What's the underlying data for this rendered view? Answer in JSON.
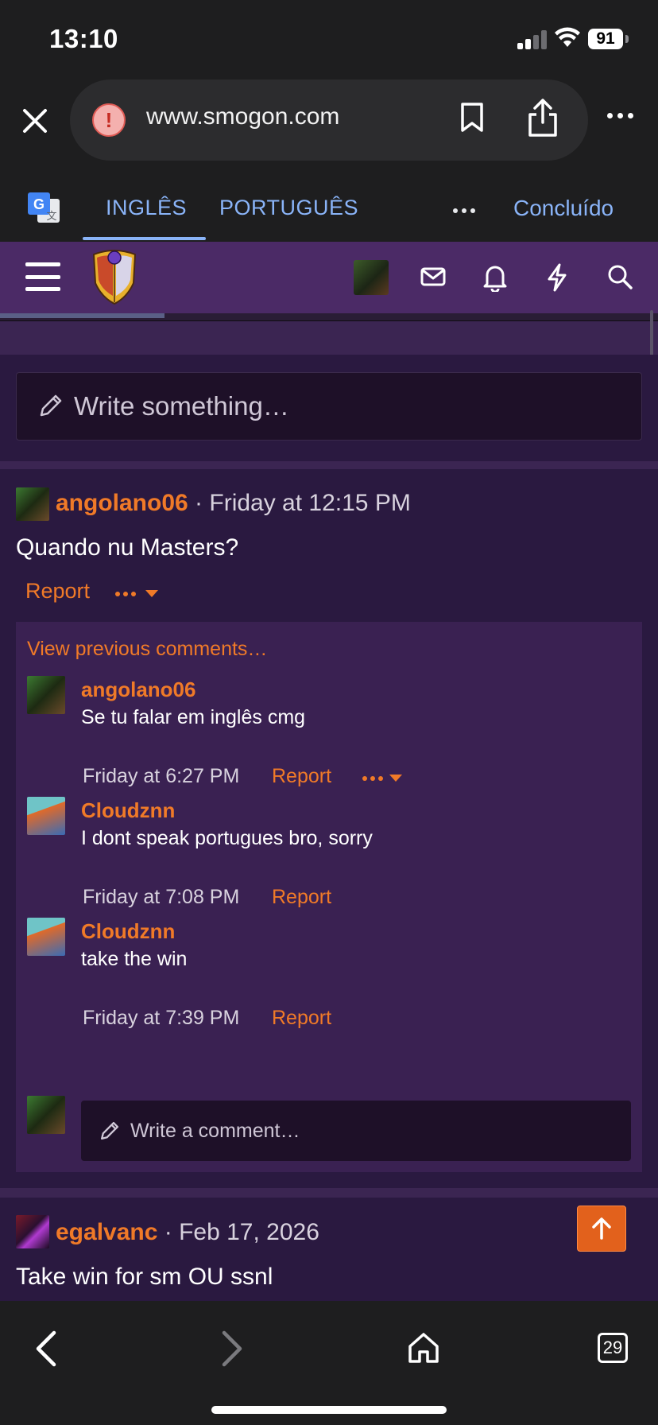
{
  "status_bar": {
    "time": "13:10",
    "battery": "91"
  },
  "browser": {
    "url": "www.smogon.com",
    "tabs_count": "29"
  },
  "translate": {
    "lang_source": "INGLÊS",
    "lang_target": "PORTUGUÊS",
    "done_label": "Concluído"
  },
  "feed": {
    "write_placeholder": "Write something…",
    "posts": [
      {
        "username": "angolano06",
        "time": "· Friday at 12:15 PM",
        "body": "Quando nu Masters?",
        "report_label": "Report",
        "view_previous": "View previous comments…",
        "comments": [
          {
            "username": "angolano06",
            "text": "Se tu falar em inglês cmg",
            "time": "Friday at 6:27 PM",
            "report_label": "Report",
            "has_more": true
          },
          {
            "username": "Cloudznn",
            "text": "I dont speak portugues bro, sorry",
            "time": "Friday at 7:08 PM",
            "report_label": "Report"
          },
          {
            "username": "Cloudznn",
            "text": "take the win",
            "time": "Friday at 7:39 PM",
            "report_label": "Report"
          }
        ],
        "comment_placeholder": "Write a comment…"
      },
      {
        "username": "egalvanc",
        "time": "· Feb 17, 2026",
        "body": "Take win for sm OU ssnl"
      }
    ]
  },
  "colors": {
    "accent": "#f07a28",
    "header_bg": "#4b2a66",
    "link_blue": "#8ab4f8"
  }
}
